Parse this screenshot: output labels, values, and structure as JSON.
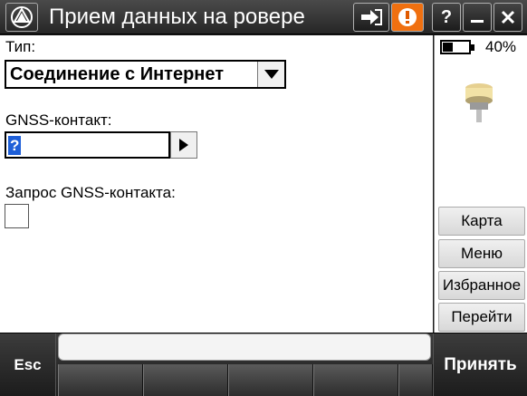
{
  "titlebar": {
    "title": "Прием данных на ровере",
    "help_label": "?",
    "app_icon": "trimble-logo-icon",
    "connect_icon": "connect-arrow-icon",
    "alert_icon": "exclamation-icon",
    "minimize_icon": "minimize-icon",
    "close_icon": "close-icon",
    "alert_color": "#f07010"
  },
  "form": {
    "type_label": "Тип:",
    "type_value": "Соединение с Интернет",
    "gnss_contact_label": "GNSS-контакт:",
    "gnss_contact_value": "?",
    "request_label": "Запрос GNSS-контакта:",
    "request_checked": false
  },
  "sidepanel": {
    "battery_percent": "40%",
    "battery_level": 0.4,
    "receiver_icon": "gnss-receiver-icon",
    "buttons": [
      {
        "label": "Карта"
      },
      {
        "label": "Меню"
      },
      {
        "label": "Избранное"
      },
      {
        "label": "Перейти"
      }
    ]
  },
  "bottombar": {
    "esc_label": "Esc",
    "accept_label": "Принять",
    "message": ""
  }
}
